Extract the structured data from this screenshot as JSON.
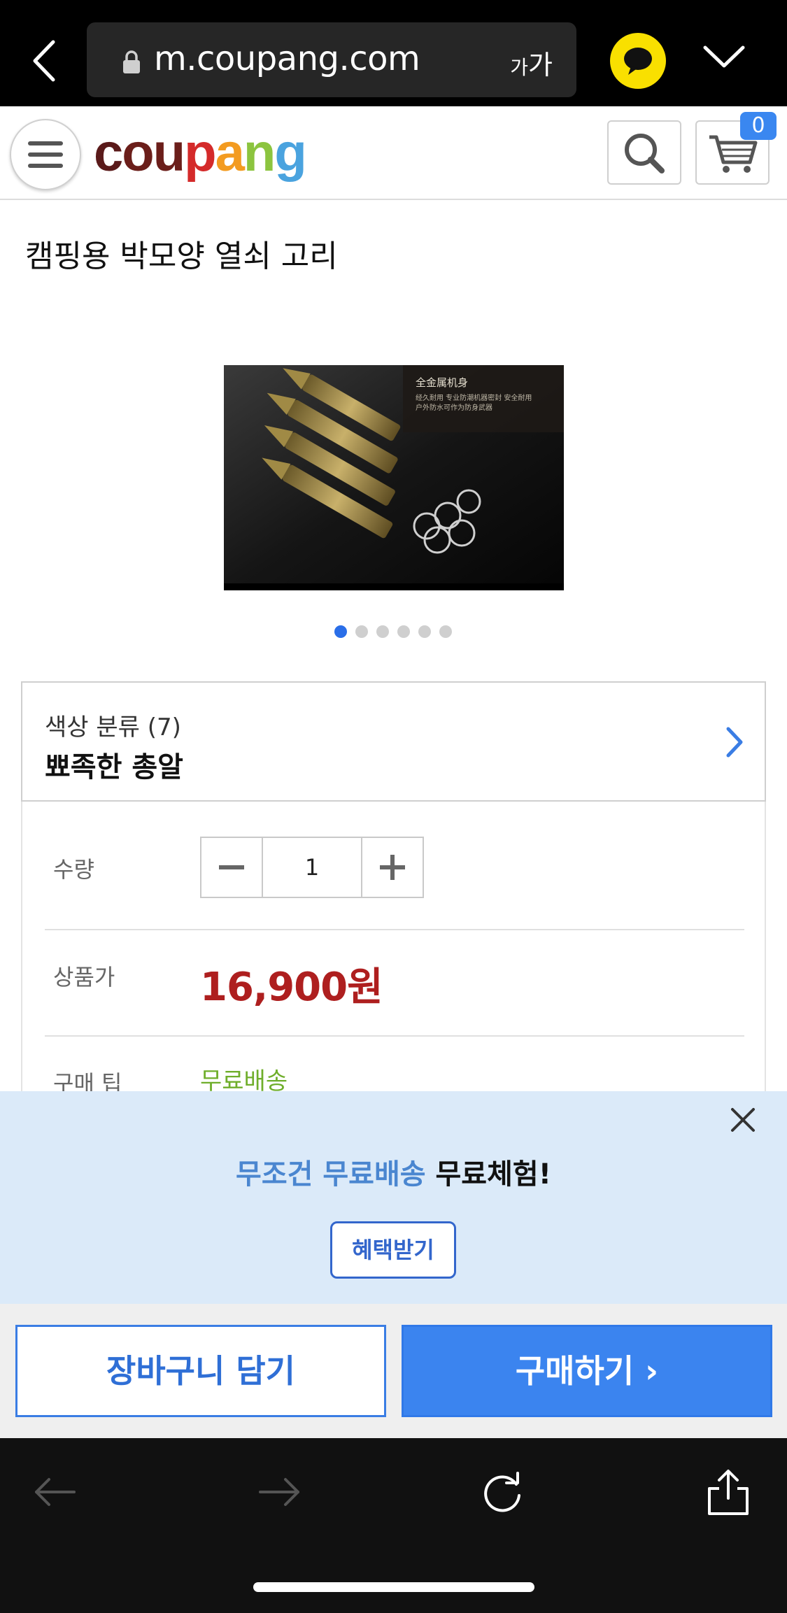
{
  "browser": {
    "url": "m.coupang.com",
    "text_size_label_small": "가",
    "text_size_label_large": "가"
  },
  "header": {
    "logo_letters": [
      "c",
      "o",
      "u",
      "p",
      "a",
      "n",
      "g"
    ],
    "cart_count": "0"
  },
  "product": {
    "title": "캠핑용 박모양 열쇠 고리",
    "image_caption": "全金属机身",
    "image_subcaption_1": "经久耐用 专业防潮机器密封 安全耐用",
    "image_subcaption_2": "户外防水可作为防身武器",
    "image_count": 6,
    "active_image_index": 0
  },
  "option": {
    "label": "색상 분류 (7)",
    "value": "뾰족한 총알"
  },
  "details": {
    "qty_label": "수량",
    "qty_value": "1",
    "price_label": "상품가",
    "price_value": "16,900원",
    "tip_label": "구매 팁",
    "tip_value": "무료배송"
  },
  "promo": {
    "text_blue": "무조건 무료배송",
    "text_black": "무료체험!",
    "button_label": "혜택받기"
  },
  "actions": {
    "add_to_cart_label": "장바구니 담기",
    "buy_label": "구매하기 ›"
  },
  "colors": {
    "accent_blue": "#3b84ef",
    "price_red": "#ae1f1f",
    "free_shipping_green": "#6fae2b",
    "promo_bg": "#dbeaf9",
    "kakao_yellow": "#f9e000"
  }
}
